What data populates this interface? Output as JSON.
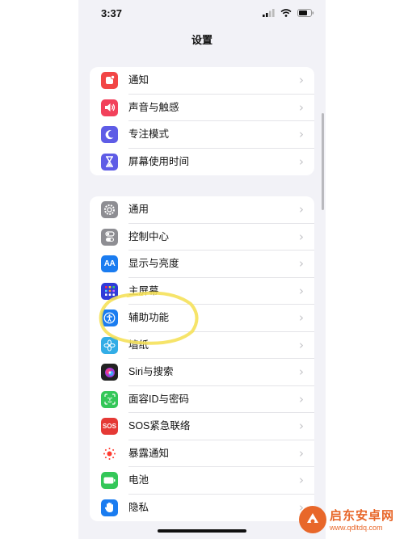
{
  "status_bar": {
    "time": "3:37"
  },
  "nav": {
    "title": "设置"
  },
  "groups": [
    {
      "items": [
        {
          "label": "通知",
          "icon": "notifications-icon",
          "color": "#f24646"
        },
        {
          "label": "声音与触感",
          "icon": "speaker-icon",
          "color": "#f2415b"
        },
        {
          "label": "专注模式",
          "icon": "moon-icon",
          "color": "#5e5ce6"
        },
        {
          "label": "屏幕使用时间",
          "icon": "hourglass-icon",
          "color": "#5e5ce6"
        }
      ]
    },
    {
      "items": [
        {
          "label": "通用",
          "icon": "gear-icon",
          "color": "#8e8e93"
        },
        {
          "label": "控制中心",
          "icon": "toggles-icon",
          "color": "#8e8e93"
        },
        {
          "label": "显示与亮度",
          "icon": "text-size-icon",
          "color": "#1a7cf0"
        },
        {
          "label": "主屏幕",
          "icon": "home-grid-icon",
          "color": "#2f3bd9"
        },
        {
          "label": "辅助功能",
          "icon": "accessibility-icon",
          "color": "#1a7cf0"
        },
        {
          "label": "墙纸",
          "icon": "flower-icon",
          "color": "#32ade6"
        },
        {
          "label": "Siri与搜索",
          "icon": "siri-icon",
          "color": "#222222"
        },
        {
          "label": "面容ID与密码",
          "icon": "face-id-icon",
          "color": "#34c759"
        },
        {
          "label": "SOS紧急联络",
          "icon": "sos-icon",
          "color": "#e53935"
        },
        {
          "label": "暴露通知",
          "icon": "exposure-icon",
          "color": "#ffffff"
        },
        {
          "label": "电池",
          "icon": "battery-icon",
          "color": "#34c759"
        },
        {
          "label": "隐私",
          "icon": "hand-icon",
          "color": "#1a7cf0"
        }
      ]
    }
  ],
  "sos_icon_text": "SOS",
  "text_size_icon_text": "AA",
  "watermark": {
    "title": "启东安卓网",
    "url": "www.qdltdq.com"
  }
}
